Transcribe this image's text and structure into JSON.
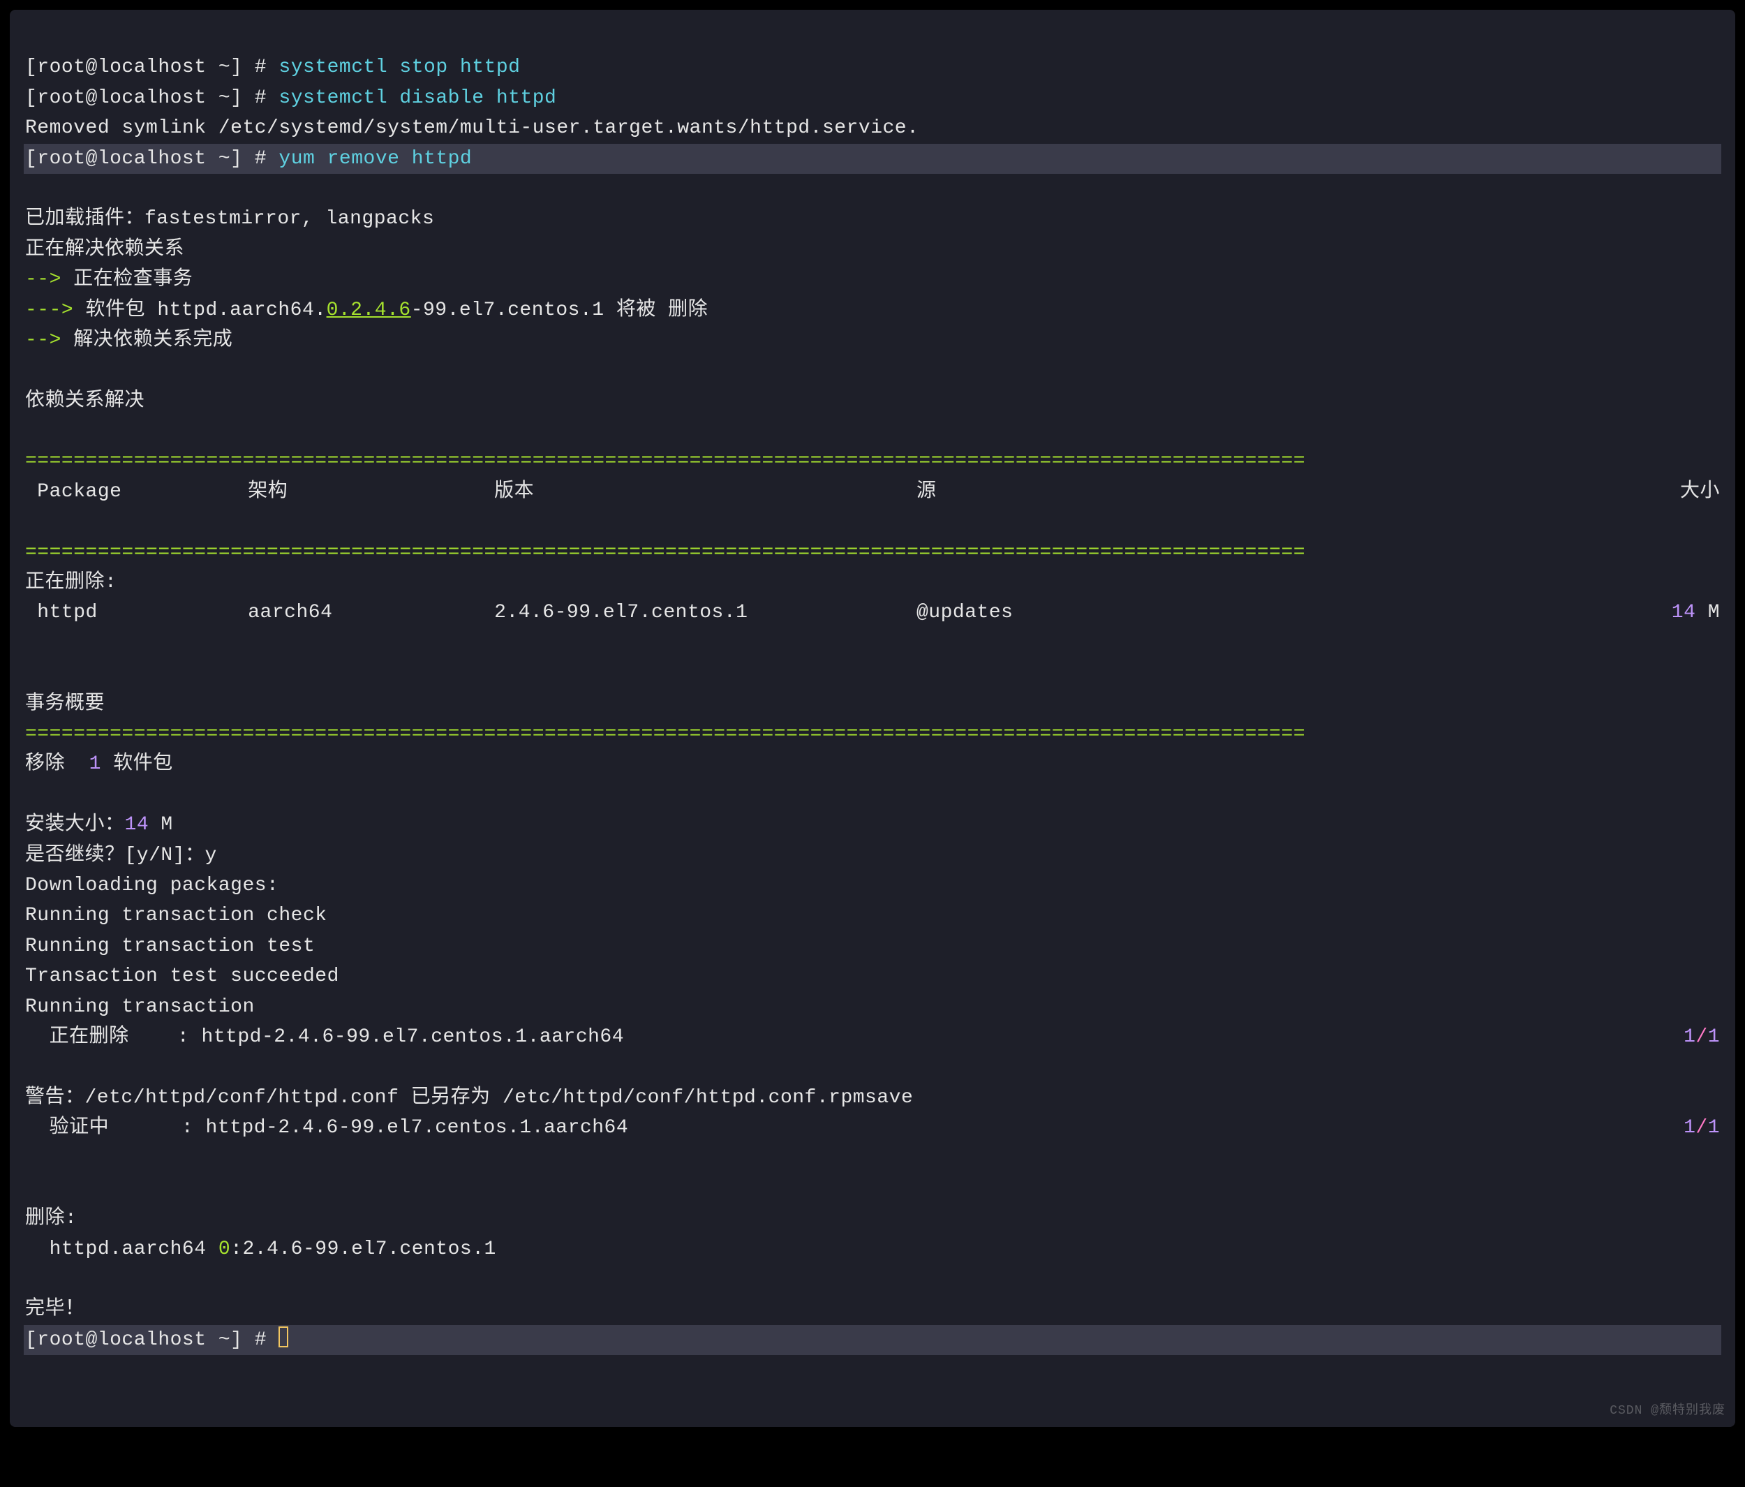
{
  "prompt": "[root@localhost ~]",
  "hash": "#",
  "cmd1": "systemctl stop httpd",
  "cmd2": "systemctl disable httpd",
  "removed_symlink": "Removed symlink /etc/systemd/system/multi-user.target.wants/httpd.service.",
  "cmd3": "yum remove httpd",
  "plugins": "已加载插件：fastestmirror, langpacks",
  "resolving": "正在解决依赖关系",
  "arrow": "-->",
  "arrow3": "--->",
  "checking": " 正在检查事务",
  "pkg_pre": " 软件包 httpd.aarch64.",
  "pkg_ver_link": "0.2.4.6",
  "pkg_post": "-99.el7.centos.1 将被 删除",
  "dep_done": " 解决依赖关系完成",
  "dep_header": "依赖关系解决",
  "eqbar": "==========================================================================================================",
  "hdr_package": " Package",
  "hdr_arch": "架构",
  "hdr_version": "版本",
  "hdr_source": "源",
  "hdr_size": "大小",
  "removing_hdr": "正在删除:",
  "row_pkg": " httpd",
  "row_arch": "aarch64",
  "row_ver": "2.4.6-99.el7.centos.1",
  "row_src": "@updates",
  "row_size_num": "14",
  "row_size_unit": " M",
  "trans_summary": "事务概要",
  "remove_label": "移除  ",
  "remove_count": "1",
  "remove_suffix": " 软件包",
  "install_size_label": "安装大小：",
  "install_size_num": "14",
  "install_size_unit": " M",
  "continue_q": "是否继续？[y/N]：",
  "continue_a": "y",
  "downloading": "Downloading packages:",
  "rtc": "Running transaction check",
  "rtt": "Running transaction test",
  "tts": "Transaction test succeeded",
  "rt": "Running transaction",
  "deleting_label": "  正在删除    : ",
  "deleting_pkg": "httpd-2.4.6-99.el7.centos.1.aarch64",
  "one_one_a": "1",
  "one_one_sep": "/",
  "one_one_b": "1",
  "warn": "警告：/etc/httpd/conf/httpd.conf 已另存为 /etc/httpd/conf/httpd.conf.rpmsave",
  "verify_label": "  验证中      : ",
  "verify_pkg": "httpd-2.4.6-99.el7.centos.1.aarch64",
  "removed_hdr": "删除:",
  "removed_line_a": "  httpd.aarch64 ",
  "removed_line_zero": "0",
  "removed_line_b": ":2.4.6-99.el7.centos.1",
  "done": "完毕！",
  "watermark": "CSDN @颓特别我废"
}
